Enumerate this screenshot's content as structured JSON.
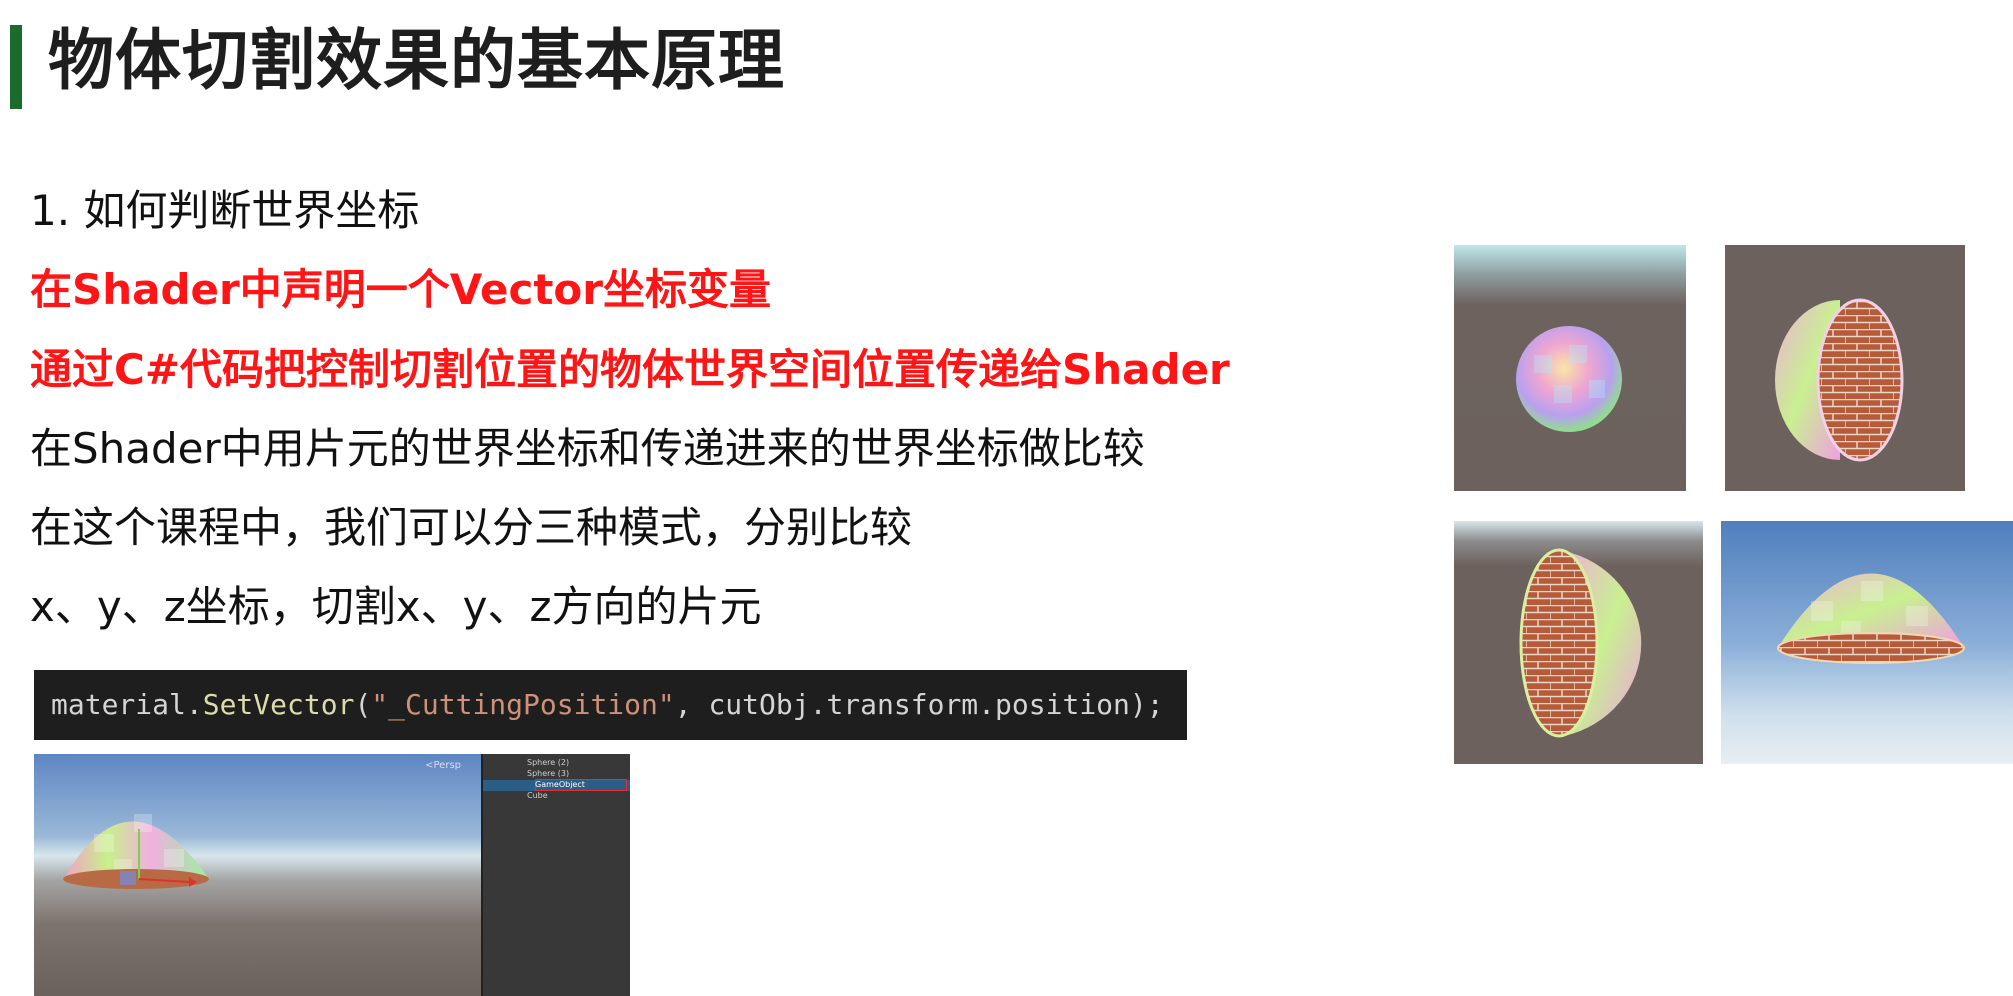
{
  "slide": {
    "title": "物体切割效果的基本原理",
    "lines": [
      "1. 如何判断世界坐标",
      "在Shader中声明一个Vector坐标变量",
      "通过C#代码把控制切割位置的物体世界空间位置传递给Shader",
      "在Shader中用片元的世界坐标和传递进来的世界坐标做比较",
      "在这个课程中，我们可以分三种模式，分别比较",
      "x、y、z坐标，切割x、y、z方向的片元"
    ],
    "code": {
      "obj": "material.",
      "method": "SetVector",
      "open": "(",
      "string": "\"_CuttingPosition\"",
      "rest": ", cutObj.transform.position);"
    },
    "editor": {
      "persp_label": "<Persp",
      "hierarchy": [
        "Sphere (2)",
        "Sphere (3)",
        "GameObject",
        "Cube"
      ]
    }
  },
  "colors": {
    "accent_bar": "#1b6b2c",
    "highlight_text": "#ff1515",
    "code_bg": "#1e1e1e"
  }
}
